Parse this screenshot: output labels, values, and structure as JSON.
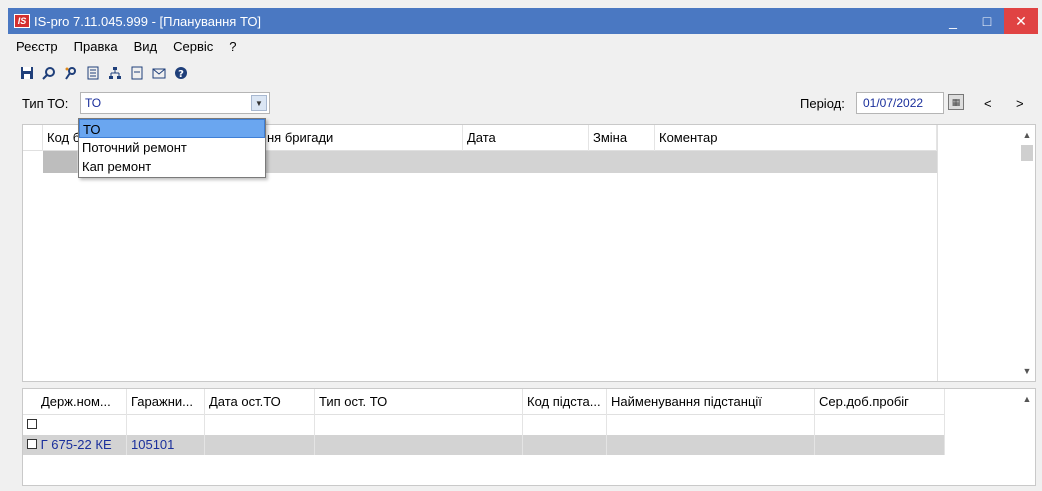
{
  "window": {
    "logo_text": "IS",
    "title": "IS-pro 7.11.045.999 - [Планування ТО]",
    "minimize": "_",
    "maximize": "□",
    "close": "✕"
  },
  "menu": [
    "Реєстр",
    "Правка",
    "Вид",
    "Сервіс",
    "?"
  ],
  "toolbar": {
    "icons": [
      "save-icon",
      "search-icon",
      "tools-icon",
      "report-icon",
      "hierarchy-icon",
      "document-icon",
      "mail-icon",
      "help-icon"
    ]
  },
  "filter": {
    "type_label": "Тип ТО:",
    "type_value": "ТО",
    "period_label": "Період:",
    "period_value": "01/07/2022",
    "prev": "<",
    "next": ">"
  },
  "dropdown": {
    "options": [
      "ТО",
      "Поточний ремонт",
      "Кап ремонт"
    ],
    "selected_index": 0
  },
  "top_grid": {
    "columns": [
      "Код б",
      "ня бригади",
      "Дата",
      "Зміна",
      "Коментар"
    ]
  },
  "bottom_grid": {
    "columns": [
      "Держ.ном...",
      "Гаражни...",
      "Дата ост.ТО",
      "Тип ост. ТО",
      "Код підста...",
      "Найменування підстанції",
      "Сер.доб.пробіг"
    ],
    "rows": [
      {
        "checked": false,
        "cells": [
          "",
          "",
          "",
          "",
          "",
          "",
          ""
        ]
      },
      {
        "checked": false,
        "cells": [
          "Г 675-22 КЕ",
          "105101",
          "",
          "",
          "",
          "",
          ""
        ]
      }
    ]
  },
  "colors": {
    "titlebar": "#4a78c2",
    "close_button": "#e04343",
    "selection": "#6aa6f0",
    "value_text": "#1a2f9c"
  }
}
